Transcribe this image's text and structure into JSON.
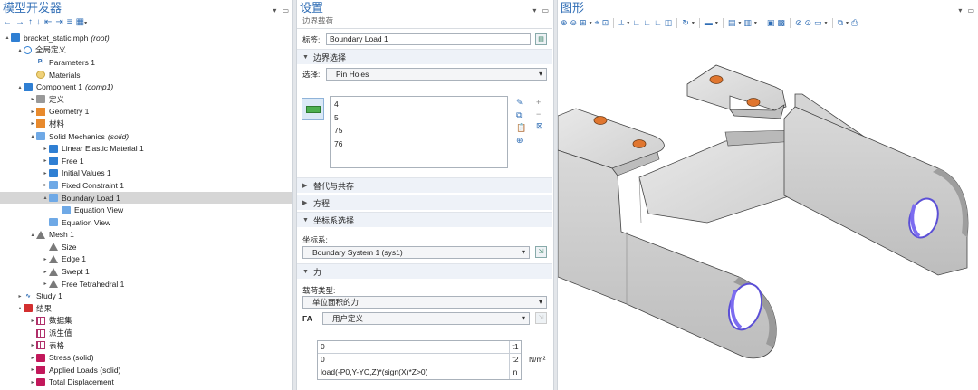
{
  "left": {
    "title": "模型开发器",
    "toolbar_icons": [
      "arrow-left-icon",
      "arrow-right-icon",
      "arrow-up-icon",
      "arrow-down-icon",
      "collapse-icon",
      "expand-icon",
      "show-icon",
      "menu-icon"
    ],
    "tree": [
      {
        "level": 0,
        "expand": "▴",
        "icon": "model-icon",
        "label": "bracket_static.mph",
        "note": "(root)"
      },
      {
        "level": 1,
        "expand": "▴",
        "icon": "globe-icon",
        "label": "全局定义",
        "note": ""
      },
      {
        "level": 2,
        "expand": "",
        "icon": "parameters-icon",
        "label": "Parameters 1",
        "note": ""
      },
      {
        "level": 2,
        "expand": "",
        "icon": "materials-icon",
        "label": "Materials",
        "note": ""
      },
      {
        "level": 1,
        "expand": "▴",
        "icon": "component-icon",
        "label": "Component 1",
        "note": "(comp1)"
      },
      {
        "level": 2,
        "expand": "▸",
        "icon": "definitions-icon",
        "label": "定义",
        "note": ""
      },
      {
        "level": 2,
        "expand": "▸",
        "icon": "geometry-icon",
        "label": "Geometry 1",
        "note": ""
      },
      {
        "level": 2,
        "expand": "▸",
        "icon": "material-icon",
        "label": "材料",
        "note": ""
      },
      {
        "level": 2,
        "expand": "▴",
        "icon": "solid-mechanics-icon",
        "label": "Solid Mechanics",
        "note": "(solid)"
      },
      {
        "level": 3,
        "expand": "▸",
        "icon": "linear-elastic-icon",
        "label": "Linear Elastic Material 1",
        "note": ""
      },
      {
        "level": 3,
        "expand": "▸",
        "icon": "free-icon",
        "label": "Free 1",
        "note": ""
      },
      {
        "level": 3,
        "expand": "▸",
        "icon": "initial-values-icon",
        "label": "Initial Values 1",
        "note": ""
      },
      {
        "level": 3,
        "expand": "▸",
        "icon": "fixed-constraint-icon",
        "label": "Fixed Constraint 1",
        "note": ""
      },
      {
        "level": 3,
        "expand": "▴",
        "icon": "boundary-load-icon",
        "label": "Boundary Load 1",
        "note": "",
        "selected": true
      },
      {
        "level": 4,
        "expand": "",
        "icon": "equation-icon",
        "label": "Equation View",
        "note": ""
      },
      {
        "level": 3,
        "expand": "",
        "icon": "equation-icon",
        "label": "Equation View",
        "note": ""
      },
      {
        "level": 2,
        "expand": "▴",
        "icon": "mesh-icon",
        "label": "Mesh 1",
        "note": ""
      },
      {
        "level": 3,
        "expand": "",
        "icon": "size-icon",
        "label": "Size",
        "note": ""
      },
      {
        "level": 3,
        "expand": "▸",
        "icon": "edge-icon",
        "label": "Edge 1",
        "note": ""
      },
      {
        "level": 3,
        "expand": "▸",
        "icon": "swept-icon",
        "label": "Swept 1",
        "note": ""
      },
      {
        "level": 3,
        "expand": "▸",
        "icon": "free-tetrahedral-icon",
        "label": "Free Tetrahedral 1",
        "note": ""
      },
      {
        "level": 1,
        "expand": "▸",
        "icon": "study-icon",
        "label": "Study 1",
        "note": ""
      },
      {
        "level": 1,
        "expand": "▴",
        "icon": "results-icon",
        "label": "结果",
        "note": ""
      },
      {
        "level": 2,
        "expand": "▸",
        "icon": "datasets-icon",
        "label": "数据集",
        "note": ""
      },
      {
        "level": 2,
        "expand": "",
        "icon": "derived-values-icon",
        "label": "派生值",
        "note": ""
      },
      {
        "level": 2,
        "expand": "▸",
        "icon": "tables-icon",
        "label": "表格",
        "note": ""
      },
      {
        "level": 2,
        "expand": "▸",
        "icon": "stress-plot-icon",
        "label": "Stress (solid)",
        "note": ""
      },
      {
        "level": 2,
        "expand": "▸",
        "icon": "applied-loads-icon",
        "label": "Applied Loads (solid)",
        "note": ""
      },
      {
        "level": 2,
        "expand": "▸",
        "icon": "total-displacement-icon",
        "label": "Total Displacement",
        "note": ""
      }
    ]
  },
  "mid": {
    "title": "设置",
    "subtitle": "边界载荷",
    "label_caption": "标签:",
    "label_value": "Boundary Load 1",
    "sections": {
      "boundary_selection": "边界选择",
      "override": "替代与共存",
      "equation": "方程",
      "coord_selection": "坐标系选择",
      "force": "力"
    },
    "selection_caption": "选择:",
    "selection_value": "Pin Holes",
    "selection_items": [
      "4",
      "5",
      "75",
      "76"
    ],
    "coord_caption": "坐标系:",
    "coord_value": "Boundary System 1 (sys1)",
    "load_type_caption": "载荷类型:",
    "load_type_value": "单位面积的力",
    "fa_label": "FA",
    "fa_type_value": "用户定义",
    "matrix": [
      {
        "value": "0",
        "label": "t1"
      },
      {
        "value": "0",
        "label": "t2"
      },
      {
        "value": "load(-P0,Y-YC,Z)*(sign(X)*Z>0)",
        "label": "n"
      }
    ],
    "unit": "N/m²"
  },
  "right": {
    "title": "图形"
  }
}
